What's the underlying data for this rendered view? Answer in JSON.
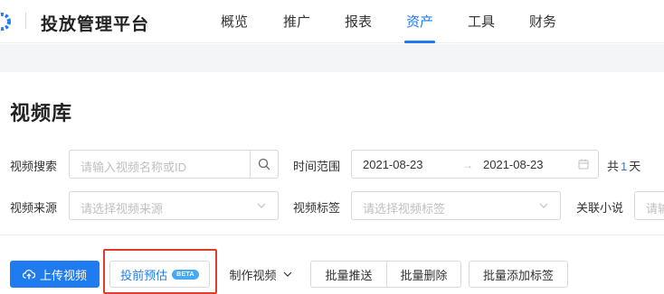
{
  "header": {
    "brand": "投放管理平台",
    "nav": [
      "概览",
      "推广",
      "报表",
      "资产",
      "工具",
      "财务"
    ],
    "active_index": 3
  },
  "page": {
    "title": "视频库"
  },
  "filters": {
    "video_search": {
      "label": "视频搜索",
      "placeholder": "请输入视频名称或ID"
    },
    "time_range": {
      "label": "时间范围",
      "start": "2021-08-23",
      "separator": "→",
      "end": "2021-08-23",
      "total_prefix": "共",
      "days": "1",
      "total_suffix": "天"
    },
    "video_source": {
      "label": "视频来源",
      "placeholder": "请选择视频来源"
    },
    "video_tag": {
      "label": "视频标签",
      "placeholder": "请选择视频标签"
    },
    "related_novel": {
      "label": "关联小说",
      "placeholder": "请输"
    }
  },
  "actions": {
    "upload": "上传视频",
    "estimate": "投前预估",
    "estimate_badge": "BETA",
    "make_video": "制作视频",
    "batch_push": "批量推送",
    "batch_delete": "批量删除",
    "batch_tag": "批量添加标签"
  },
  "colors": {
    "accent": "#1f7cf0",
    "highlight": "#e03c2f"
  }
}
